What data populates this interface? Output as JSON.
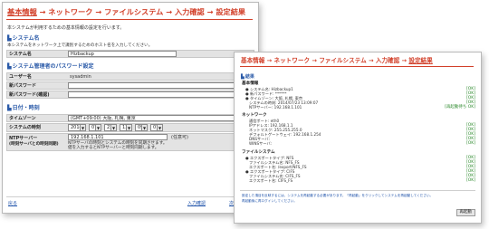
{
  "window1": {
    "breadcrumb": [
      "基本情報",
      "ネットワーク",
      "ファイルシステム",
      "入力確認",
      "設定結果"
    ],
    "arrow": "→",
    "intro": "本システムが利用するための基本情報の設定を行います。",
    "system_name": {
      "heading": "システム名",
      "desc": "本システムをネットワーク上で識別するためのホスト名を入力してください。",
      "label": "システム名",
      "value": "Hizbackup"
    },
    "admin_pw": {
      "heading": "システム管理者のパスワード設定",
      "user_label": "ユーザー名",
      "user_value": "sysadmin",
      "pw_label": "新パスワード",
      "pw_value": "",
      "pw_confirm_label": "新パスワード(確認)",
      "pw_confirm_value": ""
    },
    "datetime": {
      "heading": "日付・時刻",
      "tz_label": "タイムゾーン",
      "tz_value": "(GMT+09:00) 大阪, 札幌, 東京",
      "time_label": "システムの時刻",
      "year": "2014",
      "month": "07",
      "day": "23",
      "hour": "13",
      "minute": "09",
      "second": "07",
      "ntp_label": "NTPサーバー",
      "ntp_label2": "(時刻サーバとの時刻同期)",
      "ntp_value": "192.168.1.101",
      "ntp_note": "(任意可)",
      "ntp_desc1": "NTPサーバの時刻とシステムの時刻を同期させます。",
      "ntp_desc2": "値を入力するとNTPサーバーと時刻同期します。"
    },
    "footer": {
      "back": "戻る",
      "confirm": "入力確認",
      "next": "次へ"
    }
  },
  "window2": {
    "breadcrumb": [
      "基本情報",
      "ネットワーク",
      "ファイルシステム",
      "入力確認",
      "設定結果"
    ],
    "arrow": "→",
    "result_heading": "結果",
    "basic": {
      "title": "基本情報",
      "items": [
        {
          "text": "● システム名: Hizbackup1",
          "status": "[OK]"
        },
        {
          "text": "● 新パスワード: ******",
          "status": "[OK]"
        },
        {
          "text": "● タイムゾーン: 大阪, 札幌, 東京",
          "status": "[OK]"
        },
        {
          "text": "システムの時刻: 2014/07/23 13:09:07",
          "status": "[OK]"
        },
        {
          "text": "NTPサーバー: 192.168.1.101",
          "status": "[再起動待ち OK]"
        }
      ]
    },
    "network": {
      "title": "ネットワーク",
      "items": [
        {
          "text": "通信ポート: eth0",
          "status": ""
        },
        {
          "text": "IPアドレス: 192.168.1.1",
          "status": "[OK]"
        },
        {
          "text": "ネットマスク: 255.255.255.0",
          "status": "[OK]"
        },
        {
          "text": "デフォルトゲートウェイ: 192.168.1.254",
          "status": "[OK]"
        },
        {
          "text": "DNSサーバ:",
          "status": "[OK]"
        },
        {
          "text": "WINSサーバ:",
          "status": "[OK]"
        }
      ]
    },
    "filesystem": {
      "title": "ファイルシステム",
      "items": [
        {
          "text": "● エクスポートタイプ: NFS",
          "status": "[OK]"
        },
        {
          "text": "ファイルシステム名: NFS_FS",
          "status": "[OK]"
        },
        {
          "text": "エクスポート名: /export/NFS_FS",
          "status": "[OK]"
        },
        {
          "text": "● エクスポートタイプ: CIFS",
          "status": "[OK]"
        },
        {
          "text": "ファイルシステム名: CIFS_FS",
          "status": "[OK]"
        },
        {
          "text": "エクスポート名: CIFS_FS",
          "status": "[OK]"
        }
      ]
    },
    "footer_note1": "設定した項目を反映するには、システムを再起動する必要があります。「再起動」をクリックしてシステムを再起動してください。",
    "footer_note2": "再起動後に再ログインしてください。",
    "restart_button": "再起動"
  }
}
